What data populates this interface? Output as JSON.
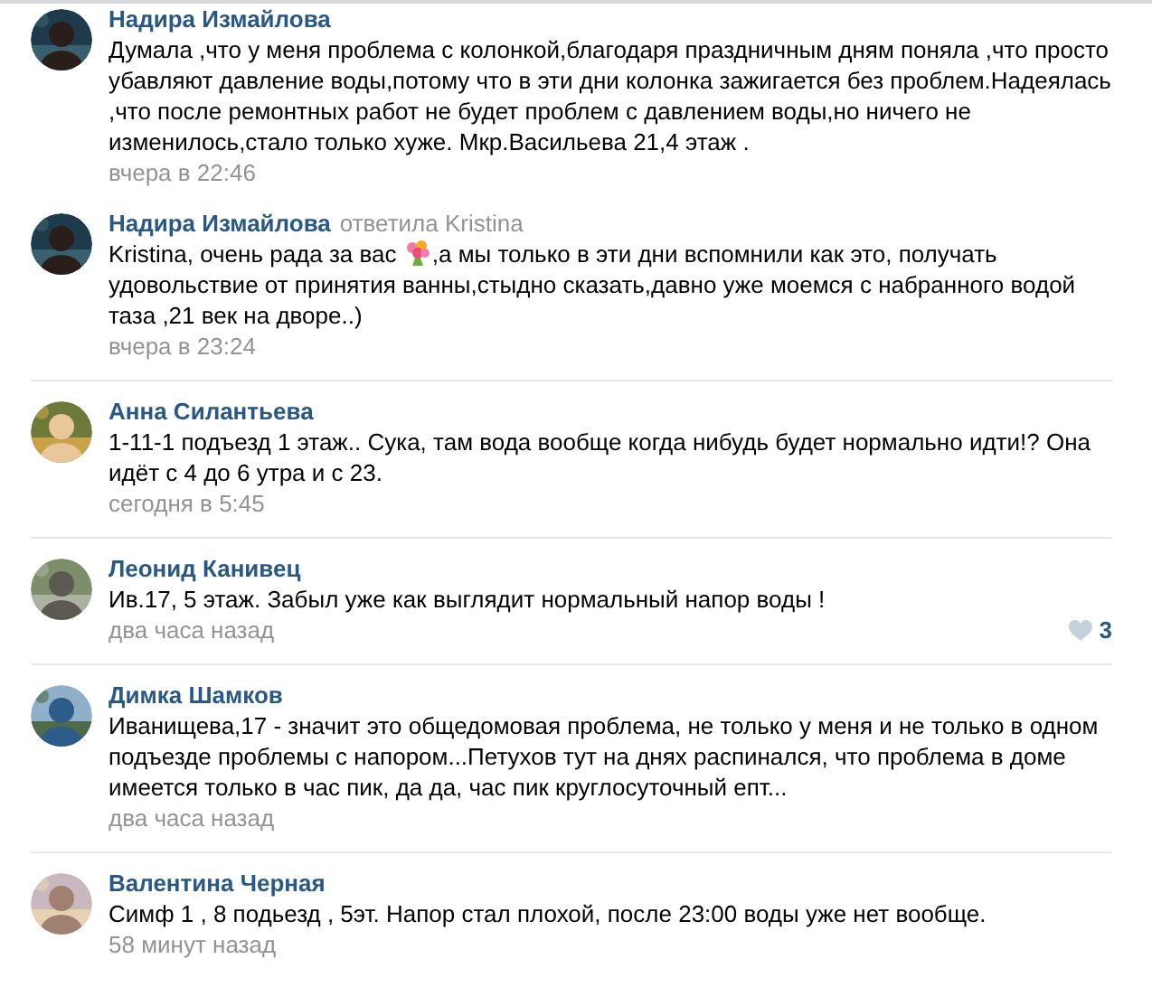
{
  "comments": [
    {
      "author": "Надира Измайлова",
      "divider_above": false,
      "parts": [
        {
          "kind": "text",
          "text": "Думала ,что у меня проблема с колонкой,благодаря праздничным дням поняла ,что просто убавляют давление воды,потому что в эти дни колонка зажигается без проблем.Надеялась ,что после ремонтных работ не будет проблем с давлением воды,но ничего не изменилось,стало только хуже. Мкр.Васильева 21,4 этаж ."
        }
      ],
      "time": "вчера в 22:46"
    },
    {
      "author": "Надира Измайлова",
      "reply_note": "ответила Kristina",
      "divider_above": false,
      "parts": [
        {
          "kind": "text",
          "text": "Kristina, очень рада за вас "
        },
        {
          "kind": "emoji"
        },
        {
          "kind": "text",
          "text": ",а мы только в эти дни вспомнили как это, получать удовольствие от принятия ванны,стыдно сказать,давно уже моемся с набранного водой таза ,21 век на дворе..)"
        }
      ],
      "time": "вчера в 23:24"
    },
    {
      "author": "Анна Силантьева",
      "divider_above": true,
      "parts": [
        {
          "kind": "text",
          "text": "1-11-1 подъезд 1 этаж.. Сука, там вода вообще когда нибудь будет нормально идти!? Она идёт с 4 до 6 утра и с 23."
        }
      ],
      "time": "сегодня в 5:45"
    },
    {
      "author": "Леонид Канивец",
      "divider_above": true,
      "parts": [
        {
          "kind": "text",
          "text": "Ив.17, 5 этаж. Забыл уже как выглядит нормальный напор воды !"
        }
      ],
      "time": "два часа назад",
      "likes": "3"
    },
    {
      "author": "Димка Шамков",
      "divider_above": true,
      "parts": [
        {
          "kind": "text",
          "text": "Иванищева,17 - значит это общедомовая проблема, не только у меня и не только в одном подъезде проблемы с напором...Петухов тут на днях распинался, что проблема в доме имеется только в час пик, да да, час пик круглосуточный епт..."
        }
      ],
      "time": "два часа назад"
    },
    {
      "author": "Валентина Черная",
      "divider_above": true,
      "parts": [
        {
          "kind": "text",
          "text": "Симф 1 , 8 подьезд , 5эт. Напор стал плохой, после 23:00 воды уже нет вообще."
        }
      ],
      "time": "58 минут назад"
    }
  ]
}
